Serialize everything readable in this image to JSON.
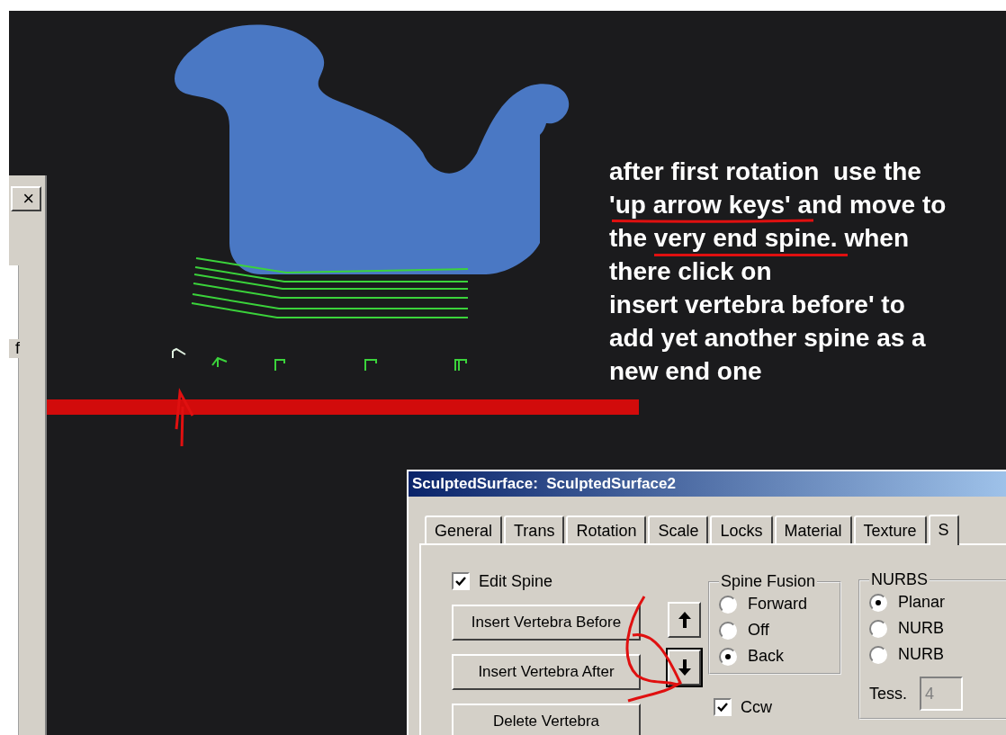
{
  "side_panel": {
    "close_label": "×",
    "tab_fragment": "f"
  },
  "viewport": {
    "annotation": {
      "lines": [
        "after first rotation  use the",
        "'up arrow keys' and move to",
        "the very end spine. when",
        "there click on",
        "insert vertebra before' to",
        "add yet another spine as a",
        "new end one"
      ]
    }
  },
  "dialog": {
    "title": "SculptedSurface:  SculptedSurface2",
    "tabs": [
      {
        "label": "General",
        "selected": false
      },
      {
        "label": "Trans",
        "selected": false
      },
      {
        "label": "Rotation",
        "selected": false
      },
      {
        "label": "Scale",
        "selected": false
      },
      {
        "label": "Locks",
        "selected": false
      },
      {
        "label": "Material",
        "selected": false
      },
      {
        "label": "Texture",
        "selected": false
      },
      {
        "label": "S",
        "selected": true
      }
    ],
    "edit_spine": {
      "label": "Edit Spine",
      "checked": true
    },
    "buttons": [
      "Insert Vertebra Before",
      "Insert Vertebra After",
      "Delete Vertebra"
    ],
    "spine_fusion": {
      "title": "Spine Fusion",
      "options": [
        {
          "label": "Forward",
          "selected": false
        },
        {
          "label": "Off",
          "selected": false
        },
        {
          "label": "Back",
          "selected": true
        }
      ]
    },
    "checkboxes": [
      {
        "label": "Ccw",
        "checked": true
      }
    ],
    "nurbs": {
      "title": "NURBS",
      "options": [
        {
          "label": "Planar",
          "selected": true
        },
        {
          "label": "NURB",
          "selected": false
        },
        {
          "label": "NURB",
          "selected": false
        }
      ],
      "tess_label": "Tess.",
      "tess_value": "4"
    }
  }
}
